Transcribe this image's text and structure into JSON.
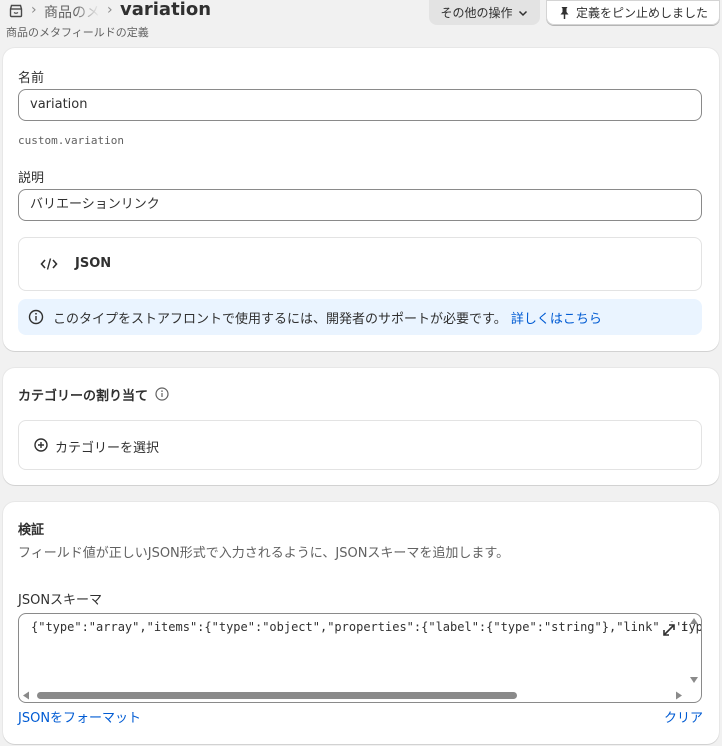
{
  "breadcrumb": {
    "home_icon": "store-icon",
    "parent": "商品のメタフィールドの定義",
    "separator": "›"
  },
  "header": {
    "title": "variation",
    "subtitle": "商品のメタフィールドの定義",
    "more_actions_label": "その他の操作",
    "pin_label": "定義をピン止めしました"
  },
  "definition": {
    "name_label": "名前",
    "name_value": "variation",
    "namespace_key": "custom.variation",
    "description_label": "説明",
    "description_value": "バリエーションリンク",
    "type_icon": "code-icon",
    "type_label": "JSON",
    "banner_text": "このタイプをストアフロントで使用するには、開発者のサポートが必要です。",
    "banner_link": "詳しくはこちら"
  },
  "category": {
    "title": "カテゴリーの割り当て",
    "select_label": "カテゴリーを選択"
  },
  "validation": {
    "title": "検証",
    "description": "フィールド値が正しいJSON形式で入力されるように、JSONスキーマを追加します。",
    "schema_label": "JSONスキーマ",
    "schema_value": "{\"type\":\"array\",\"items\":{\"type\":\"object\",\"properties\":{\"label\":{\"type\":\"string\"},\"link\":{\"type\":\"",
    "schema_tail": "i",
    "format_link": "JSONをフォーマット",
    "clear_link": "クリア"
  }
}
